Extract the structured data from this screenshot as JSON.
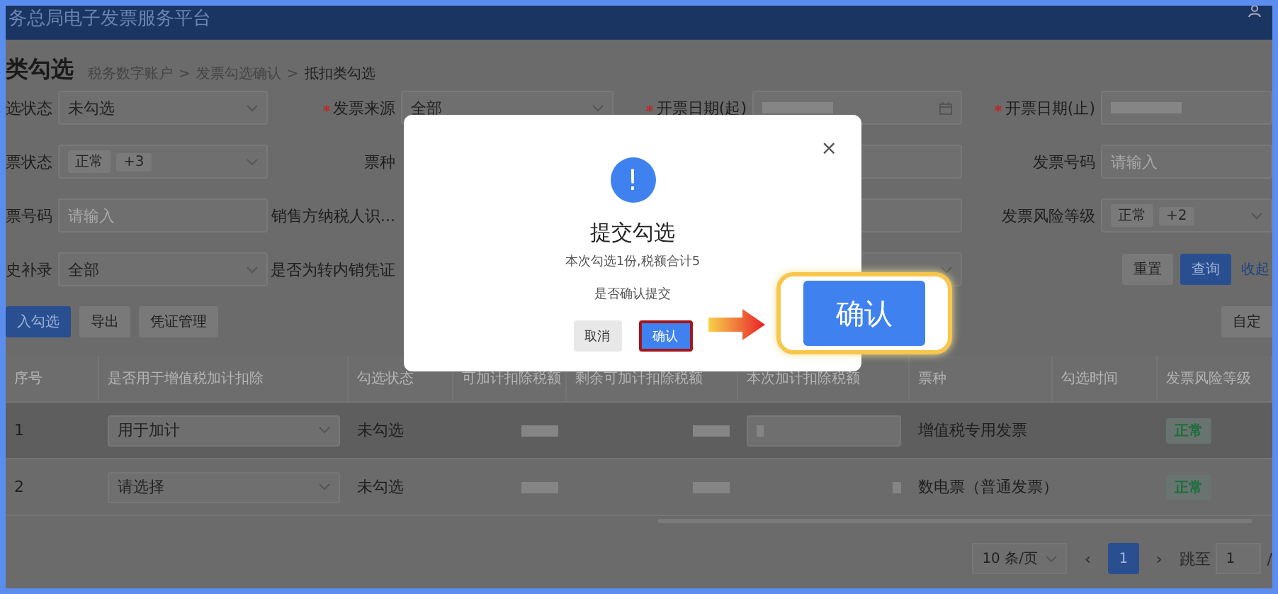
{
  "header": {
    "title": "务总局电子发票服务平台"
  },
  "page_title": "类勾选",
  "breadcrumb": [
    "税务数字账户",
    "发票勾选确认",
    "抵扣类勾选"
  ],
  "breadcrumb_separator": ">",
  "filters": [
    [
      {
        "label": "选状态",
        "kind": "select",
        "value": "未勾选"
      },
      {
        "label": "发票来源",
        "required": true,
        "kind": "select",
        "value": "全部"
      },
      {
        "label": "开票日期(起)",
        "required": true,
        "kind": "date"
      },
      {
        "label": "开票日期(止)",
        "required": true,
        "kind": "blurred"
      }
    ],
    [
      {
        "label": "票状态",
        "kind": "tags",
        "tags": [
          "正常",
          "+3"
        ]
      },
      {
        "label": "票种"
      },
      {
        "kind": "input"
      },
      {
        "label": "发票号码",
        "kind": "input",
        "placeholder": "请输入"
      }
    ],
    [
      {
        "label": "票号码",
        "kind": "input",
        "placeholder": "请输入"
      },
      {
        "label": "销售方纳税人识..."
      },
      {
        "kind": "input"
      },
      {
        "label": "发票风险等级",
        "kind": "tags",
        "tags": [
          "正常",
          "+2"
        ]
      }
    ],
    [
      {
        "label": "史补录",
        "kind": "select",
        "value": "全部"
      },
      {
        "label": "是否为转内销凭证"
      },
      {
        "kind": "select"
      },
      {
        "kind": "buttons"
      }
    ]
  ],
  "filter_buttons": [
    {
      "label": "重置",
      "kind": "default"
    },
    {
      "label": "查询",
      "kind": "primary"
    },
    {
      "label": "收起",
      "kind": "link"
    }
  ],
  "actions": [
    {
      "label": "入勾选",
      "kind": "primary"
    },
    {
      "label": "导出",
      "kind": "default"
    },
    {
      "label": "凭证管理",
      "kind": "default"
    }
  ],
  "custom_button": "自定",
  "table": {
    "columns": [
      "序号",
      "是否用于增值税加计扣除",
      "勾选状态",
      "可加计扣除税额",
      "剩余可加计扣除税额",
      "本次加计扣除税额",
      "票种",
      "勾选时间",
      "发票风险等级"
    ],
    "rows": [
      {
        "index": "1",
        "deduction": "用于加计",
        "status": "未勾选",
        "amount_input": true,
        "type": "增值税专用发票",
        "risk": "正常",
        "hover": true
      },
      {
        "index": "2",
        "deduction": "请选择",
        "status": "未勾选",
        "amount_input": false,
        "type": "数电票（普通发票）",
        "risk": "正常",
        "hover": false
      }
    ]
  },
  "pagination": {
    "page_size": "10 条/页",
    "prev": "‹",
    "pages": [
      {
        "label": "1",
        "selected": true
      }
    ],
    "next": "›",
    "jump_label": "跳至",
    "jump_value": "1",
    "total": "/"
  },
  "dialog": {
    "title": "提交勾选",
    "message": "本次勾选1份,税额合计5",
    "question": "是否确认提交",
    "close": "×",
    "icon": "!",
    "buttons": [
      {
        "label": "取消",
        "kind": "default",
        "highlighted": false
      },
      {
        "label": "确认",
        "kind": "primary",
        "highlighted": true
      }
    ]
  },
  "callout": {
    "label": "确认"
  }
}
